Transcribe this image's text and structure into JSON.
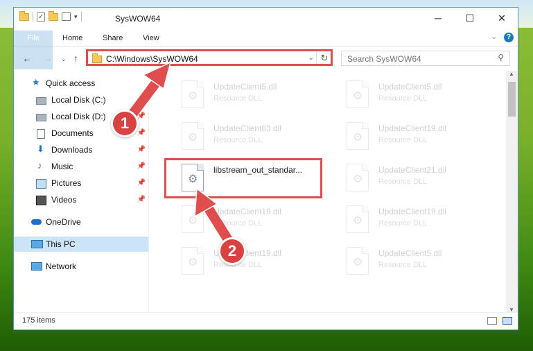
{
  "window": {
    "title": "SysWOW64",
    "controls": {
      "minimize": "─",
      "maximize": "☐",
      "close": "✕"
    }
  },
  "ribbon": {
    "tabs": [
      "File",
      "Home",
      "Share",
      "View"
    ],
    "collapse": "⌄",
    "help": "?"
  },
  "nav_buttons": {
    "back": "←",
    "forward": "→",
    "recent": "⌄",
    "up": "↑"
  },
  "address": {
    "path": "C:\\Windows\\SysWOW64",
    "dropdown": "⌄",
    "refresh": "↻"
  },
  "search": {
    "placeholder": "Search SysWOW64",
    "icon": "⚲"
  },
  "sidebar": {
    "items": [
      {
        "label": "Quick access",
        "icon": "star-icon"
      },
      {
        "label": "Local Disk (C:)",
        "icon": "drive-icon",
        "pinned": true
      },
      {
        "label": "Local Disk (D:)",
        "icon": "drive-icon",
        "pinned": true
      },
      {
        "label": "Documents",
        "icon": "documents-icon",
        "pinned": true
      },
      {
        "label": "Downloads",
        "icon": "download-icon",
        "pinned": true
      },
      {
        "label": "Music",
        "icon": "music-icon",
        "pinned": true
      },
      {
        "label": "Pictures",
        "icon": "pictures-icon",
        "pinned": true
      },
      {
        "label": "Videos",
        "icon": "videos-icon",
        "pinned": true
      },
      {
        "label": "OneDrive",
        "icon": "cloud-icon"
      },
      {
        "label": "This PC",
        "icon": "computer-icon",
        "selected": true
      },
      {
        "label": "Network",
        "icon": "network-icon"
      }
    ],
    "pin_glyph": "📌"
  },
  "files": [
    {
      "name": "UpdateClient5.dll",
      "type": "Resource DLL"
    },
    {
      "name": "UpdateClient5.dll",
      "type": "Resource DLL"
    },
    {
      "name": "UpdateClient63.dll",
      "type": "Resource DLL"
    },
    {
      "name": "UpdateClient19.dll",
      "type": "Resource DLL"
    },
    {
      "name": "libstream_out_standar...",
      "type": "",
      "highlighted": true
    },
    {
      "name": "UpdateClient21.dll",
      "type": "Resource DLL"
    },
    {
      "name": "UpdateClient19.dll",
      "type": "Resource DLL"
    },
    {
      "name": "UpdateClient19.dll",
      "type": "Resource DLL"
    },
    {
      "name": "UpdateClient19.dll",
      "type": "Resource DLL"
    },
    {
      "name": "UpdateClient5.dll",
      "type": "Resource DLL"
    }
  ],
  "status": {
    "item_count": "175 items"
  },
  "annotations": {
    "step1": "1",
    "step2": "2"
  },
  "colors": {
    "accent": "#1979ca",
    "highlight": "#e14d4d",
    "badge": "#d94242"
  }
}
